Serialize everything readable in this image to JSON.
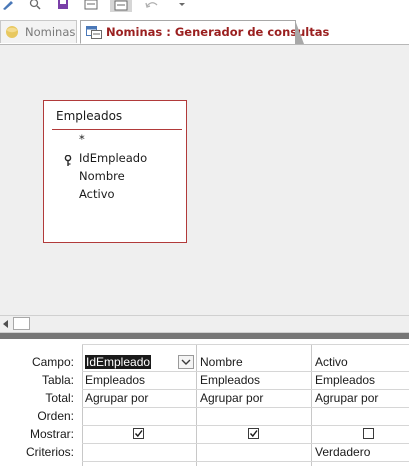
{
  "tabs": [
    {
      "label": "Nominas",
      "active": false,
      "icon": "access-db-icon"
    },
    {
      "label": "Nominas : Generador de consultas",
      "active": true,
      "icon": "query-design-icon"
    }
  ],
  "table_box": {
    "title": "Empleados",
    "fields": [
      "*",
      "IdEmpleado",
      "Nombre",
      "Activo"
    ],
    "primary_key": "IdEmpleado"
  },
  "grid": {
    "row_labels": [
      "Campo:",
      "Tabla:",
      "Total:",
      "Orden:",
      "Mostrar:",
      "Criterios:"
    ],
    "columns": [
      {
        "campo": "IdEmpleado",
        "tabla": "Empleados",
        "total": "Agrupar por",
        "orden": "",
        "mostrar": true,
        "criterios": ""
      },
      {
        "campo": "Nombre",
        "tabla": "Empleados",
        "total": "Agrupar por",
        "orden": "",
        "mostrar": true,
        "criterios": ""
      },
      {
        "campo": "Activo",
        "tabla": "Empleados",
        "total": "Agrupar por",
        "orden": "",
        "mostrar": false,
        "criterios": "Verdadero"
      }
    ]
  },
  "colors": {
    "accent": "#9a1f1f",
    "table_border": "#b13a3a",
    "splitter": "#767676"
  }
}
